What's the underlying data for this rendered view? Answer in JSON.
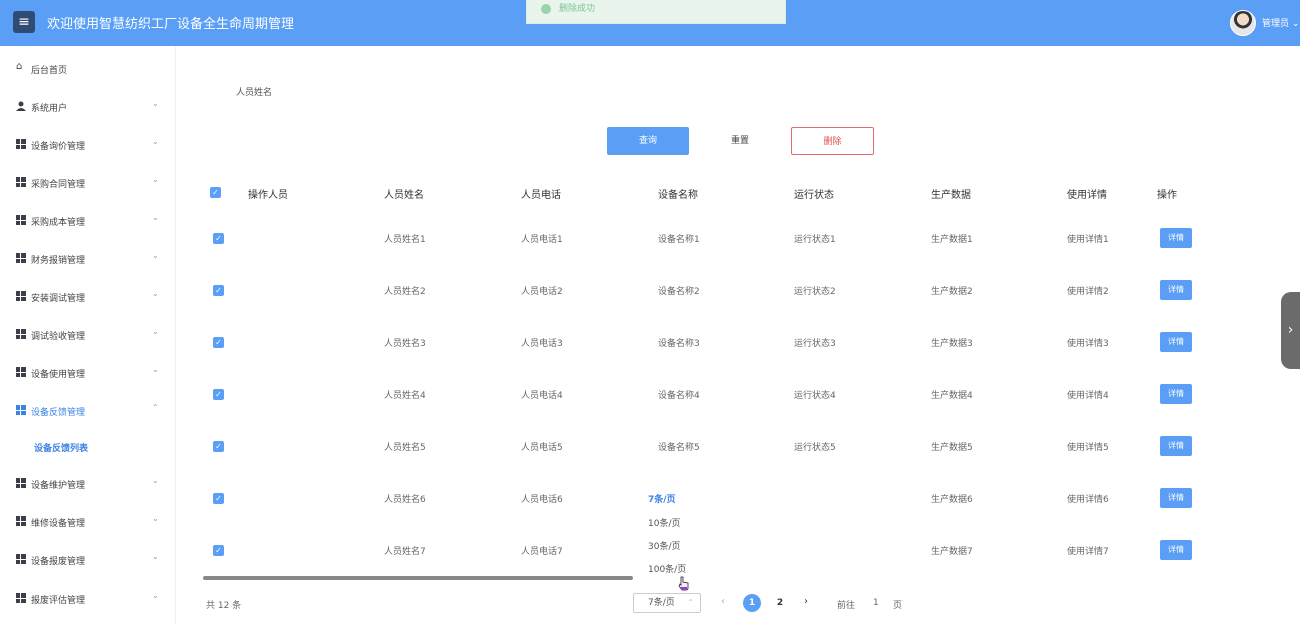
{
  "header": {
    "menu_icon": "menu-icon",
    "title": "欢迎使用智慧纺织工厂设备全生命周期管理",
    "toast": "删除成功",
    "admin": "管理员"
  },
  "sidebar": {
    "items": [
      {
        "label": "后台首页",
        "icon": "home-icon"
      },
      {
        "label": "系统用户",
        "icon": "user-icon"
      },
      {
        "label": "设备询价管理",
        "icon": "grid-icon"
      },
      {
        "label": "采购合同管理",
        "icon": "grid-icon"
      },
      {
        "label": "采购成本管理",
        "icon": "grid-icon"
      },
      {
        "label": "财务报销管理",
        "icon": "grid-icon"
      },
      {
        "label": "安装调试管理",
        "icon": "grid-icon"
      },
      {
        "label": "调试验收管理",
        "icon": "grid-icon"
      },
      {
        "label": "设备使用管理",
        "icon": "grid-icon"
      },
      {
        "label": "设备反馈管理",
        "icon": "grid-icon"
      },
      {
        "label": "设备维护管理",
        "icon": "grid-icon"
      },
      {
        "label": "维修设备管理",
        "icon": "grid-icon"
      },
      {
        "label": "设备报废管理",
        "icon": "grid-icon"
      },
      {
        "label": "报废评估管理",
        "icon": "grid-icon"
      }
    ],
    "sub_item": "设备反馈列表"
  },
  "search": {
    "label": "人员姓名",
    "query_button": "查询",
    "reset_button": "重置",
    "delete_button": "删除"
  },
  "table": {
    "headers": [
      "操作人员",
      "人员姓名",
      "人员电话",
      "设备名称",
      "运行状态",
      "生产数据",
      "使用详情",
      "操作"
    ],
    "rows": [
      {
        "name": "人员姓名1",
        "phone": "人员电话1",
        "device": "设备名称1",
        "status": "运行状态1",
        "prod": "生产数据1",
        "usage": "使用详情1"
      },
      {
        "name": "人员姓名2",
        "phone": "人员电话2",
        "device": "设备名称2",
        "status": "运行状态2",
        "prod": "生产数据2",
        "usage": "使用详情2"
      },
      {
        "name": "人员姓名3",
        "phone": "人员电话3",
        "device": "设备名称3",
        "status": "运行状态3",
        "prod": "生产数据3",
        "usage": "使用详情3"
      },
      {
        "name": "人员姓名4",
        "phone": "人员电话4",
        "device": "设备名称4",
        "status": "运行状态4",
        "prod": "生产数据4",
        "usage": "使用详情4"
      },
      {
        "name": "人员姓名5",
        "phone": "人员电话5",
        "device": "设备名称5",
        "status": "运行状态5",
        "prod": "生产数据5",
        "usage": "使用详情5"
      },
      {
        "name": "人员姓名6",
        "phone": "人员电话6",
        "device": "",
        "status": "",
        "prod": "生产数据6",
        "usage": "使用详情6"
      },
      {
        "name": "人员姓名7",
        "phone": "人员电话7",
        "device": "",
        "status": "",
        "prod": "生产数据7",
        "usage": "使用详情7"
      }
    ],
    "detail_label": "详情"
  },
  "page_size_dropdown": {
    "options": [
      "7条/页",
      "10条/页",
      "30条/页",
      "100条/页"
    ],
    "selected": "7条/页"
  },
  "pagination": {
    "total": "共 12 条",
    "page_size": "7条/页",
    "pages": [
      "1",
      "2"
    ],
    "current": "1",
    "goto_prefix": "前往",
    "goto_value": "1",
    "goto_suffix": "页"
  },
  "colors": {
    "header_bg": "#5a9ff5",
    "accent": "#3c83e6",
    "danger": "#e05050"
  }
}
